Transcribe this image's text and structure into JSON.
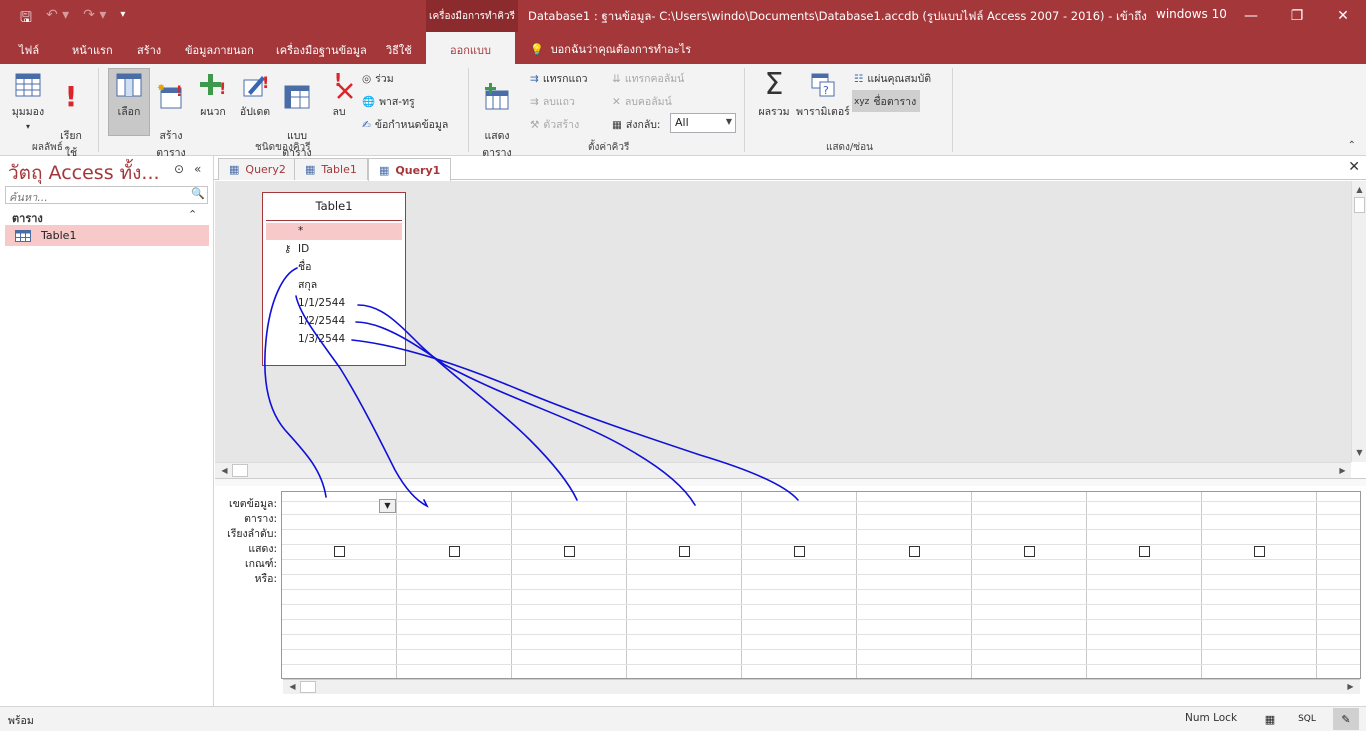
{
  "titlebar": {
    "contextual_tab": "เครื่องมือการทำคิวรี",
    "window_title": "Database1 : ฐานข้อมูล- C:\\Users\\windo\\Documents\\Database1.accdb (รูปแบบไฟล์ Access 2007 - 2016)  -  เข้าถึง",
    "user": "windows 10"
  },
  "ribbon_tabs": [
    "ไฟล์",
    "หน้าแรก",
    "สร้าง",
    "ข้อมูลภายนอก",
    "เครื่องมือฐานข้อมูล",
    "วิธีใช้",
    "ออกแบบ"
  ],
  "tell_me": "บอกฉันว่าคุณต้องการทำอะไร",
  "ribbon": {
    "view": "มุมมอง",
    "run": "เรียก\nใช้",
    "results_group": "ผลลัพธ์",
    "select": "เลือก",
    "make_table": "สร้าง\nตาราง",
    "append": "ผนวก",
    "update": "อัปเดต",
    "crosstab": "แบบ\nตาราง",
    "delete": "ลบ",
    "union": "ร่วม",
    "pass_through": "พาส-ทรู",
    "data_definition": "ข้อกำหนดข้อมูล",
    "query_type_group": "ชนิดของคิวรี",
    "show_table": "แสดง\nตาราง",
    "insert_rows": "แทรกแถว",
    "delete_rows": "ลบแถว",
    "builder": "ตัวสร้าง",
    "insert_columns": "แทรกคอลัมน์",
    "delete_columns": "ลบคอลัมน์",
    "return_label": "ส่งกลับ:",
    "return_value": "All",
    "query_setup_group": "ตั้งค่าคิวรี",
    "totals": "ผลรวม",
    "parameters": "พารามิเตอร์",
    "property_sheet": "แผ่นคุณสมบัติ",
    "table_names": "ชื่อตาราง",
    "show_hide_group": "แสดง/ซ่อน"
  },
  "nav": {
    "title": "วัตถุ Access ทั้ง...",
    "search_placeholder": "ค้นหา...",
    "group": "ตาราง",
    "items": [
      "Table1"
    ]
  },
  "doc_tabs": [
    "Query2",
    "Table1",
    "Query1"
  ],
  "field_list": {
    "title": "Table1",
    "fields": [
      "*",
      "ID",
      "ชื่อ",
      "สกุล",
      "1/1/2544",
      "1/2/2544",
      "1/3/2544"
    ]
  },
  "grid": {
    "row_labels": [
      "เขตข้อมูล:",
      "ตาราง:",
      "เรียงลำดับ:",
      "แสดง:",
      "เกณฑ์:",
      "หรือ:"
    ]
  },
  "status": {
    "left": "พร้อม",
    "num_lock": "Num Lock",
    "sql": "SQL"
  },
  "colors": {
    "accent": "#a4373a",
    "selection": "#f7c9c9",
    "ink": "#1010d8"
  },
  "icons": [
    "save-icon",
    "undo-icon",
    "redo-icon",
    "customize-icon",
    "view-icon",
    "run-icon",
    "select-query-icon",
    "make-table-icon",
    "append-icon",
    "update-icon",
    "crosstab-icon",
    "delete-query-icon",
    "union-icon",
    "pass-through-icon",
    "data-definition-icon",
    "show-table-icon",
    "totals-icon",
    "parameters-icon",
    "property-sheet-icon",
    "table-names-icon",
    "lightbulb-icon",
    "search-icon",
    "table-icon",
    "query-icon",
    "key-icon"
  ]
}
